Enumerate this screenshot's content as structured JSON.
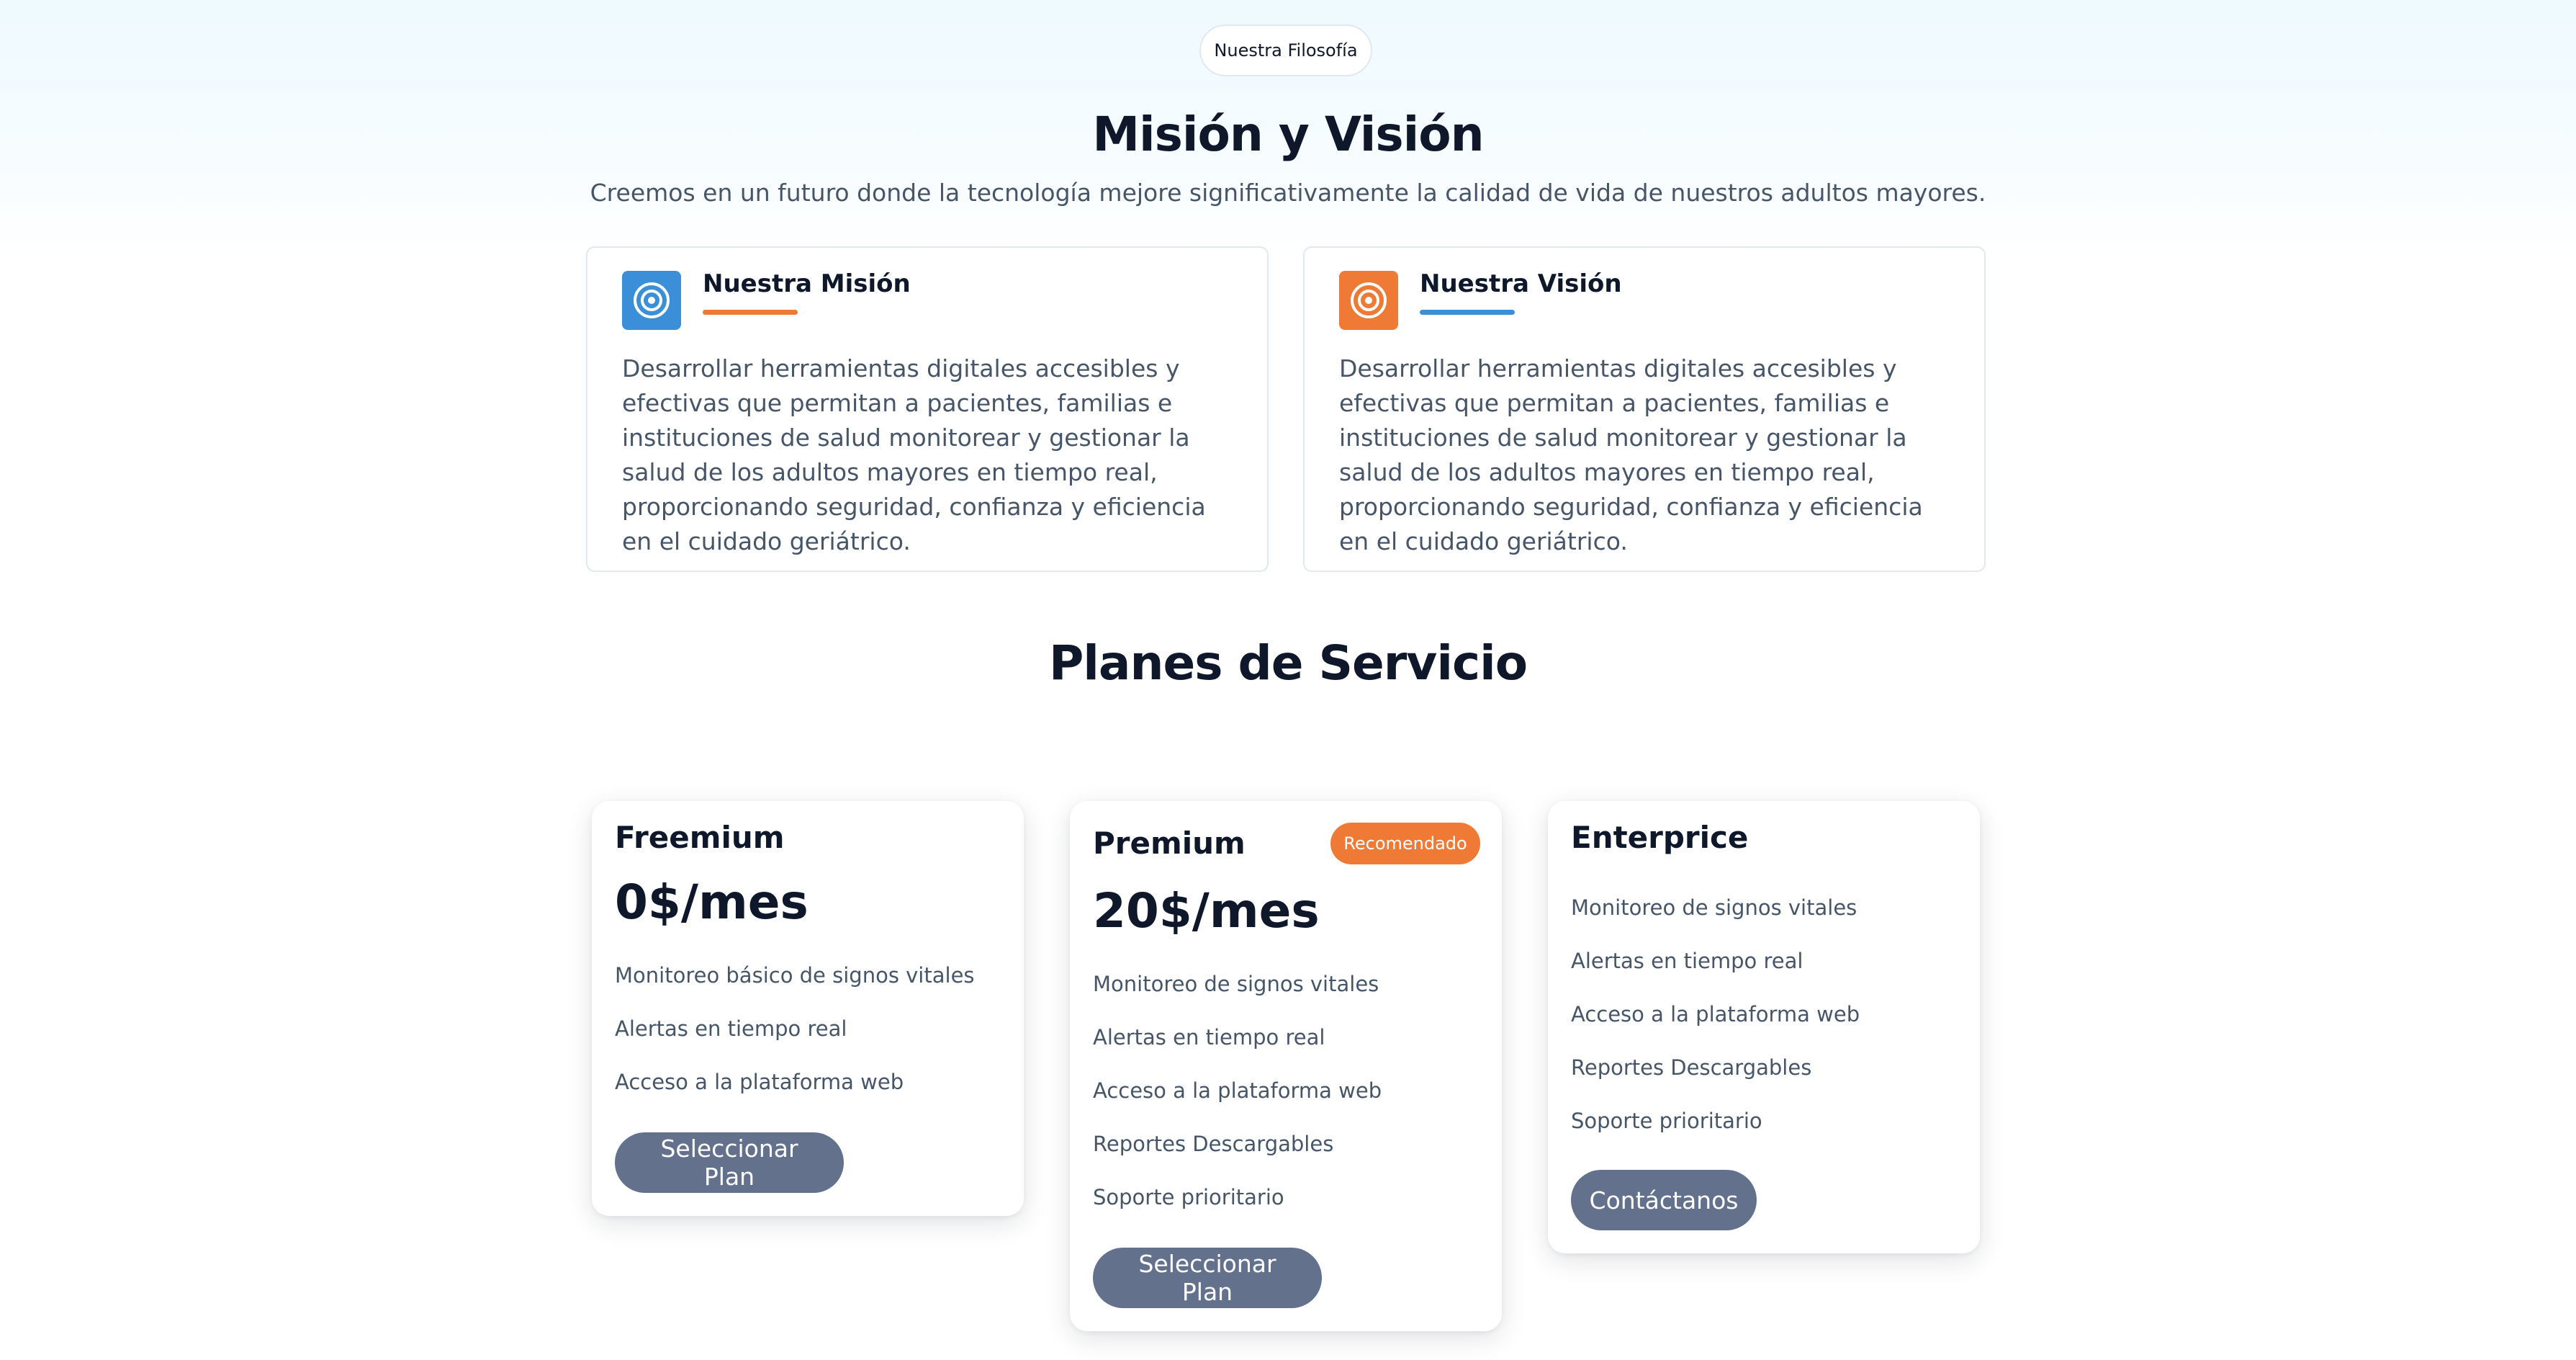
{
  "header": {
    "pill_label": "Nuestra Filosofía",
    "title": "Misión y Visión",
    "subtitle": "Creemos en un futuro donde la tecnología mejore significativamente la calidad de vida de nuestros adultos mayores."
  },
  "mision": {
    "title": "Nuestra Misión",
    "icon": "target-icon",
    "icon_color": "#3b8fd9",
    "underline_color": "#ee7a35",
    "text": "Desarrollar herramientas digitales accesibles y efectivas que permitan a pacientes, familias e instituciones de salud monitorear y gestionar la salud de los adultos mayores en tiempo real, proporcionando seguridad, confianza y eficiencia en el cuidado geriátrico."
  },
  "vision": {
    "title": "Nuestra Visión",
    "icon": "target-icon",
    "icon_color": "#ee7a35",
    "underline_color": "#3b8fd9",
    "text": "Desarrollar herramientas digitales accesibles y efectivas que permitan a pacientes, familias e instituciones de salud monitorear y gestionar la salud de los adultos mayores en tiempo real, proporcionando seguridad, confianza y eficiencia en el cuidado geriátrico."
  },
  "plans": {
    "section_title": "Planes de Servicio",
    "freemium": {
      "name": "Freemium",
      "price": "0$/mes",
      "features": [
        "Monitoreo básico de signos vitales",
        "Alertas en tiempo real",
        "Acceso a la plataforma web"
      ],
      "button": "Seleccionar Plan"
    },
    "premium": {
      "name": "Premium",
      "badge": "Recomendado",
      "price": "20$/mes",
      "features": [
        "Monitoreo de signos vitales",
        "Alertas en tiempo real",
        "Acceso a la plataforma web",
        "Reportes Descargables",
        "Soporte prioritario"
      ],
      "button": "Seleccionar Plan"
    },
    "enterprice": {
      "name": "Enterprice",
      "features": [
        "Monitoreo de signos vitales",
        "Alertas en tiempo real",
        "Acceso a la plataforma web",
        "Reportes Descargables",
        "Soporte prioritario"
      ],
      "button": "Contáctanos"
    }
  },
  "colors": {
    "accent_orange": "#ee7a35",
    "accent_blue": "#3b8fd9",
    "button_bg": "#64718c"
  }
}
